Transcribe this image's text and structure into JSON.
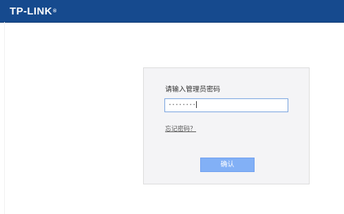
{
  "header": {
    "logo_text": "TP-LINK",
    "logo_mark": "®"
  },
  "login": {
    "prompt": "请输入管理员密码",
    "password_value": "········"
  },
  "links": {
    "forgot_password": "忘记密码？"
  },
  "actions": {
    "confirm_label": "确认"
  },
  "colors": {
    "header_blue": "#164a8e",
    "card_background": "#f4f4f6",
    "input_border": "#7ea7df",
    "button_blue": "#82b0f6"
  },
  "icons": {
    "logo": "tp-link-logo"
  }
}
